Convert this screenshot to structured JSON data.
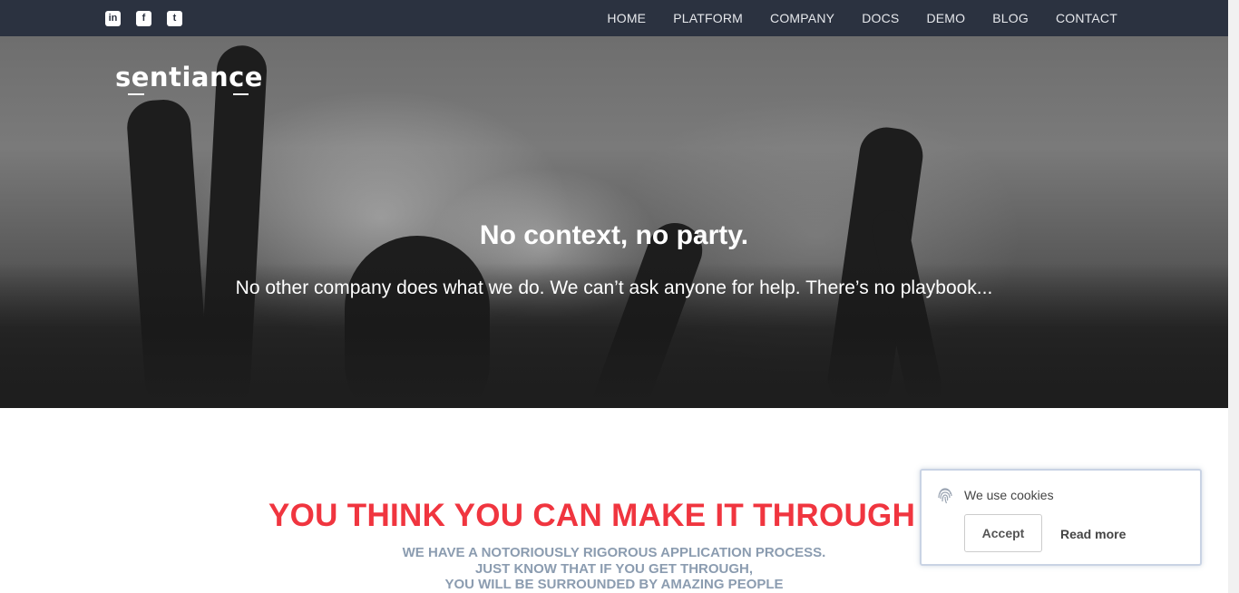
{
  "nav": {
    "items": [
      "HOME",
      "PLATFORM",
      "COMPANY",
      "DOCS",
      "DEMO",
      "BLOG",
      "CONTACT"
    ]
  },
  "social": {
    "linkedin_glyph": "in",
    "facebook_glyph": "f",
    "twitter_glyph": "t"
  },
  "hero": {
    "logo": "sentiance",
    "title": "No context, no party.",
    "subtitle": "No other company does what we do. We can’t ask anyone for help. There’s no playbook..."
  },
  "section": {
    "heading": "YOU THINK YOU CAN MAKE IT THROUGH THIS",
    "lines": [
      "WE HAVE A NOTORIOUSLY RIGOROUS APPLICATION PROCESS.",
      "JUST KNOW THAT IF YOU GET THROUGH,",
      "YOU WILL BE SURROUNDED BY AMAZING PEOPLE"
    ]
  },
  "cookie": {
    "message": "We use cookies",
    "accept_label": "Accept",
    "read_more_label": "Read more"
  },
  "colors": {
    "topbar": "#2b3240",
    "heading_red": "#f0353f",
    "subtext_blue_gray": "#8b9cb0"
  },
  "icons": [
    "linkedin-icon",
    "facebook-icon",
    "twitter-icon",
    "fingerprint-icon"
  ]
}
